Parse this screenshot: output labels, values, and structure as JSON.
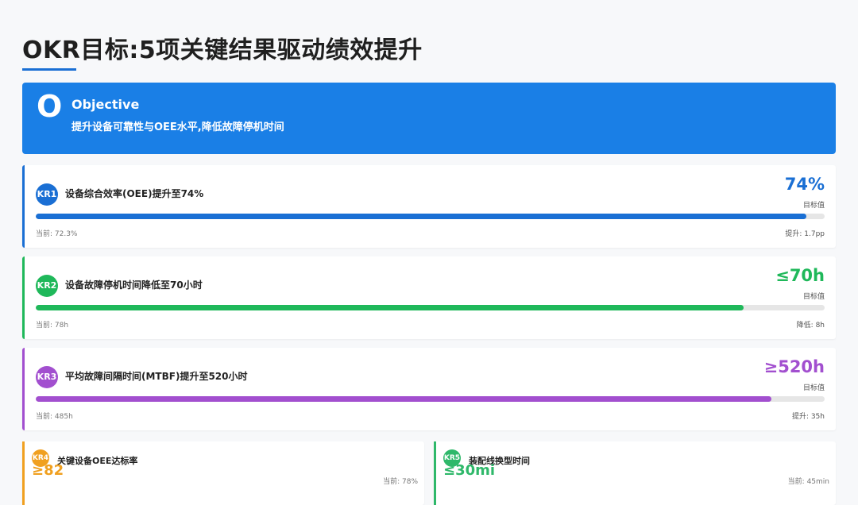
{
  "title": "OKR目标:5项关键结果驱动绩效提升",
  "objective": {
    "letter": "O",
    "heading": "Objective",
    "description": "提升设备可靠性与OEE水平,降低故障停机时间",
    "color": "#1a7fe6"
  },
  "key_results": [
    {
      "badge": "KR1",
      "label": "设备综合效率(OEE)提升至74%",
      "target": "74%",
      "target_caption": "目标值",
      "current": "当前: 72.3%",
      "delta": "提升: 1.7pp",
      "progress": 0.977,
      "color": "#1a6fd4"
    },
    {
      "badge": "KR2",
      "label": "设备故障停机时间降低至70小时",
      "target": "≤70h",
      "target_caption": "目标值",
      "current": "当前: 78h",
      "delta": "降低: 8h",
      "progress": 0.897,
      "color": "#1fb85a"
    },
    {
      "badge": "KR3",
      "label": "平均故障间隔时间(MTBF)提升至520小时",
      "target": "≥520h",
      "target_caption": "目标值",
      "current": "当前: 485h",
      "delta": "提升: 35h",
      "progress": 0.933,
      "color": "#a24fcf"
    }
  ],
  "small_key_results": [
    {
      "badge": "KR4",
      "label": "关键设备OEE达标率",
      "target": "≥82",
      "current": "当前: 78%",
      "color": "#f0a020"
    },
    {
      "badge": "KR5",
      "label": "装配线换型时间",
      "target": "≤30mi",
      "current": "当前: 45min",
      "color": "#2fb86a"
    }
  ]
}
